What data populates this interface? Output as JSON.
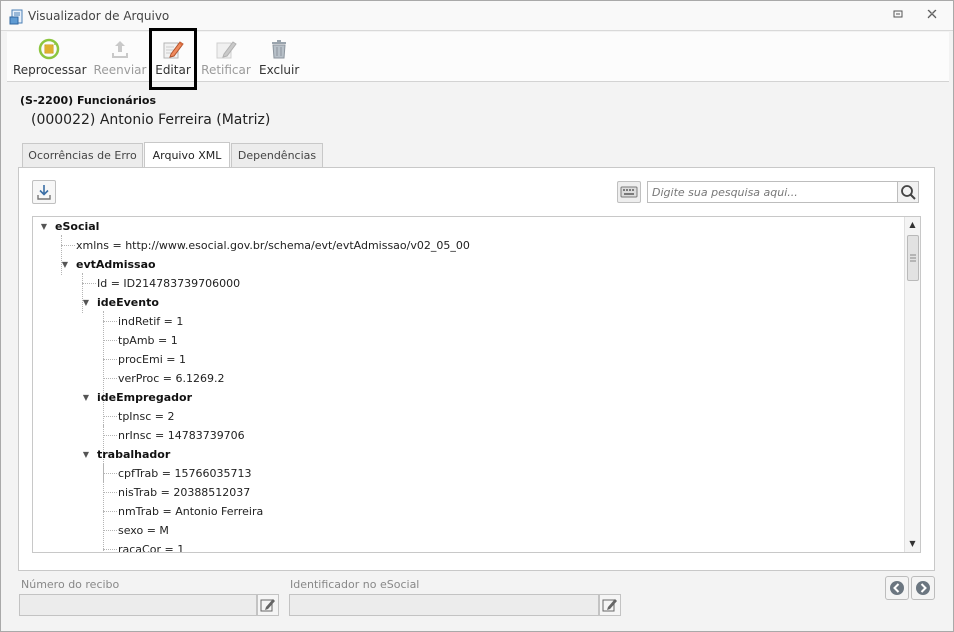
{
  "window": {
    "title": "Visualizador de Arquivo"
  },
  "toolbar": {
    "reprocess_label": "Reprocessar",
    "resend_label": "Reenviar",
    "edit_label": "Editar",
    "rectify_label": "Retificar",
    "delete_label": "Excluir"
  },
  "event": {
    "code": "(S-2200) Funcionários",
    "name": "(000022) Antonio Ferreira (Matriz)"
  },
  "tabs": [
    "Ocorrências de Erro",
    "Arquivo XML",
    "Dependências"
  ],
  "search": {
    "placeholder": "Digite sua pesquisa aqui..."
  },
  "tree": {
    "nodes": [
      "eSocial",
      "xmlns = http://www.esocial.gov.br/schema/evt/evtAdmissao/v02_05_00",
      "evtAdmissao",
      "Id = ID214783739706000",
      "ideEvento",
      "indRetif = 1",
      "tpAmb = 1",
      "procEmi = 1",
      "verProc = 6.1269.2",
      "ideEmpregador",
      "tpInsc = 2",
      "nrInsc = 14783739706",
      "trabalhador",
      "cpfTrab = 15766035713",
      "nisTrab = 20388512037",
      "nmTrab = Antonio Ferreira",
      "sexo = M",
      "racaCor = 1"
    ]
  },
  "footer": {
    "receipt_label": "Número do recibo",
    "esocial_id_label": "Identificador no eSocial"
  },
  "colors": {
    "accent": "#4a7fb5",
    "edit_highlight": "#000000"
  }
}
